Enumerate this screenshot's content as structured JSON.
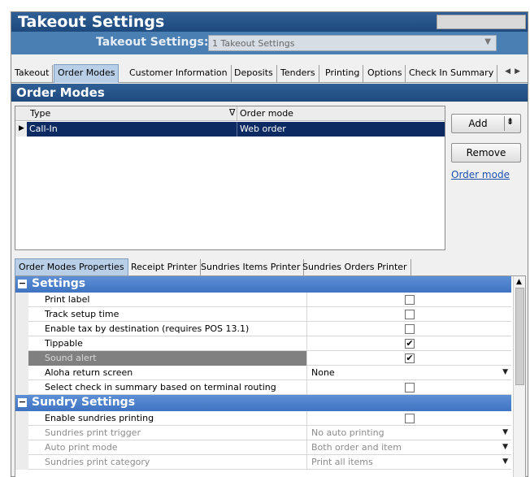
{
  "window": {
    "title": "Takeout Settings"
  },
  "selector": {
    "label": "Takeout Settings:",
    "value": "1 Takeout Settings"
  },
  "top_tabs": [
    "Takeout",
    "Order Modes",
    "Customer Information",
    "Deposits",
    "Tenders",
    "Printing",
    "Options",
    "Check In Summary"
  ],
  "top_tabs_active": "Order Modes",
  "order_modes": {
    "title": "Order Modes",
    "columns": [
      "Type",
      "Order mode"
    ],
    "rows": [
      {
        "type": "Call-In",
        "order_mode": "Web order"
      }
    ],
    "add_label": "Add",
    "remove_label": "Remove",
    "link_label": "Order mode"
  },
  "sub_tabs": [
    "Order Modes Properties",
    "Receipt Printer",
    "Sundries Items Printer",
    "Sundries Orders Printer"
  ],
  "sub_tabs_active": "Order Modes Properties",
  "settings": {
    "group_title": "Settings",
    "rows": [
      {
        "label": "Print label",
        "kind": "checkbox",
        "checked": false
      },
      {
        "label": "Track setup time",
        "kind": "checkbox",
        "checked": false
      },
      {
        "label": "Enable tax by destination (requires POS 13.1)",
        "kind": "checkbox",
        "checked": false
      },
      {
        "label": "Tippable",
        "kind": "checkbox",
        "checked": true
      },
      {
        "label": "Sound alert",
        "kind": "checkbox",
        "checked": true
      },
      {
        "label": "Aloha return screen",
        "kind": "dropdown",
        "value": "None"
      },
      {
        "label": "Select check in summary based on terminal routing",
        "kind": "checkbox",
        "checked": false
      }
    ]
  },
  "sundry": {
    "group_title": "Sundry Settings",
    "rows": [
      {
        "label": "Enable sundries printing",
        "kind": "checkbox",
        "checked": false
      },
      {
        "label": "Sundries print trigger",
        "kind": "dropdown",
        "value": "No auto printing"
      },
      {
        "label": "Auto print mode",
        "kind": "dropdown",
        "value": "Both order and item"
      },
      {
        "label": "Sundries print category",
        "kind": "dropdown",
        "value": "Print all items"
      }
    ]
  },
  "icons": {
    "grid_row_pointer": "triangle-right-icon",
    "filter": "filter-triangle-icon",
    "collapse": "minus-box-icon",
    "check": "check-icon",
    "dropdown": "triangle-down-icon",
    "scroll_up": "triangle-up-icon",
    "tab_scroll": "tab-scroll-arrows-icon"
  },
  "colors": {
    "title_bar": "#1e4a7e",
    "selector_bar": "#4a7fb3",
    "group_header": "#4a80cc",
    "selected_row": "#0d2a63",
    "link": "#1a4fb0"
  }
}
